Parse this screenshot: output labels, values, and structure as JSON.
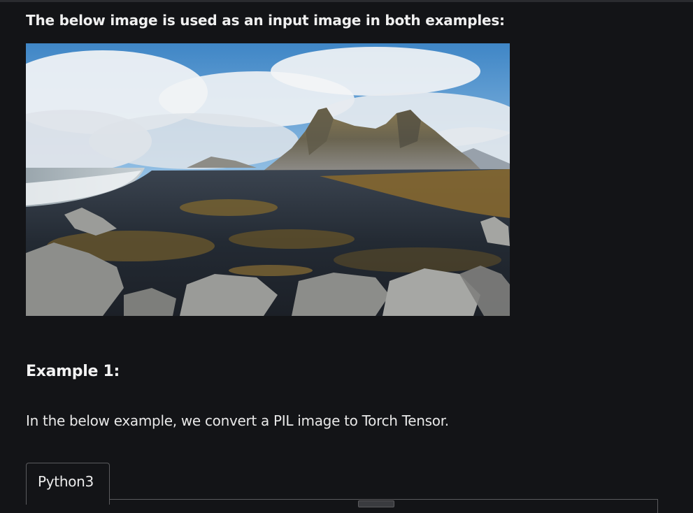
{
  "article": {
    "intro_text": "The below image is used as an input image in both examples:",
    "example_heading": "Example 1:",
    "description": "In the below example, we convert a PIL image to Torch Tensor."
  },
  "code_block": {
    "tabs": [
      {
        "label": "Python3",
        "active": true
      }
    ]
  },
  "colors": {
    "page_background": "#131417",
    "text": "#ececec",
    "border": "#5b5b5e"
  }
}
